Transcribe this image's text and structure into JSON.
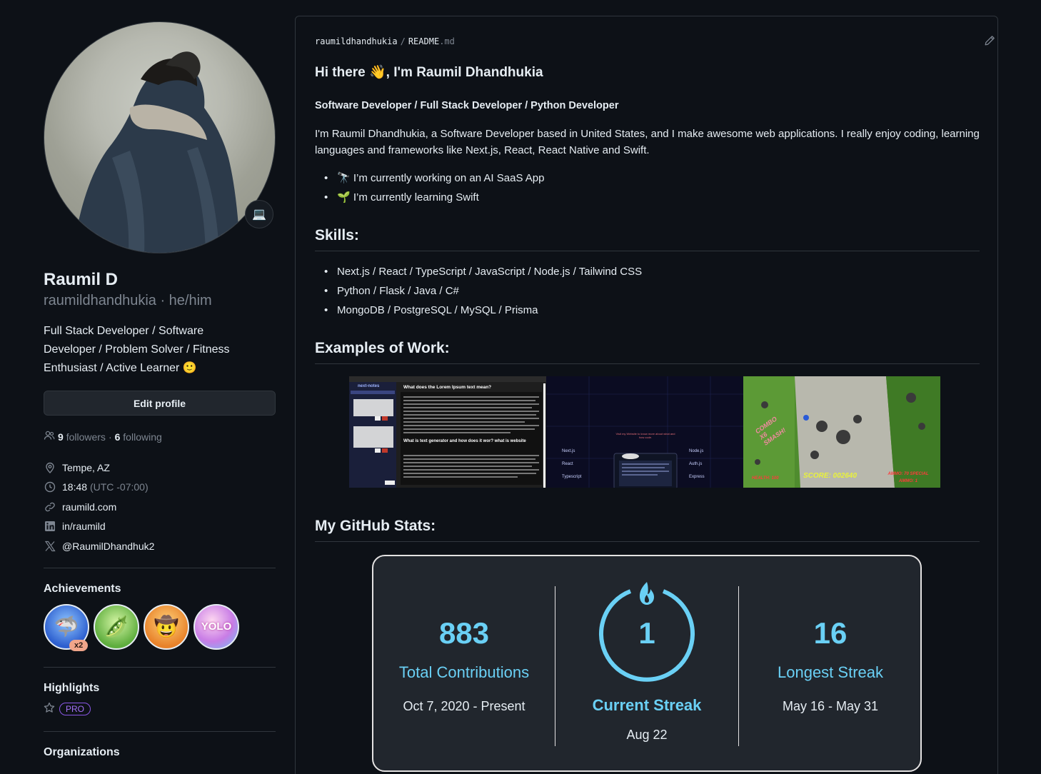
{
  "profile": {
    "name": "Raumil D",
    "login": "raumildhandhukia",
    "pronouns": "he/him",
    "bio": "Full Stack Developer / Software Developer / Problem Solver / Fitness Enthusiast / Active Learner 🙂",
    "status_emoji": "💻",
    "edit_label": "Edit profile",
    "followers_count": "9",
    "followers_label": "followers",
    "following_count": "6",
    "following_label": "following",
    "location": "Tempe, AZ",
    "local_time": "18:48",
    "timezone": "(UTC -07:00)",
    "website": "raumild.com",
    "linkedin": "in/raumild",
    "twitter": "@RaumilDhandhuk2"
  },
  "achievements": {
    "title": "Achievements",
    "badges": [
      {
        "name": "shark",
        "glyph": "🦈",
        "count": "x2",
        "color": "#3b6fd8"
      },
      {
        "name": "pea-pod",
        "glyph": "🫛",
        "color": "#6fbf4a"
      },
      {
        "name": "cowboy",
        "glyph": "🤠",
        "color": "#e88a2e"
      },
      {
        "name": "yolo",
        "glyph": "YOLO",
        "color": "#e97fc0"
      }
    ]
  },
  "highlights": {
    "title": "Highlights",
    "pro_label": "PRO"
  },
  "organizations": {
    "title": "Organizations"
  },
  "readme": {
    "path_user": "raumildhandhukia",
    "path_file": "README",
    "path_ext": ".md",
    "greeting": "Hi there 👋, I'm Raumil Dhandhukia",
    "roles": "Software Developer / Full Stack Developer / Python Developer",
    "intro": "I'm Raumil Dhandhukia, a Software Developer based in United States, and I make awesome web applications. I really enjoy coding, learning languages and frameworks like Next.js, React, React Native and Swift.",
    "bullets": [
      "🔭 I’m currently working on an AI SaaS App",
      "🌱 I’m currently learning Swift"
    ],
    "skills_title": "Skills:",
    "skills": [
      "Next.js / React / TypeScript / JavaScript / Node.js / Tailwind CSS",
      "Python / Flask / Java / C#",
      "MongoDB / PostgreSQL / MySQL / Prisma"
    ],
    "work_title": "Examples of Work:",
    "stats_title": "My GitHub Stats:"
  },
  "shots": {
    "notes_title": "What does the Lorem Ipsum text mean?",
    "notes_app": "next-notes",
    "notes_q2": "What is text generator and how does it wor? what is website",
    "portfolio_caption": "Visit my Website to know more about what and how code.",
    "portfolio_left": [
      "Next.js",
      "React",
      "Typescript"
    ],
    "portfolio_right": [
      "Node.js",
      "Auth.js",
      "Express"
    ],
    "game_score": "SCORE: 002640",
    "game_health": "HEALTH: 100",
    "game_combo": "COMBO X6 SMASH!",
    "game_ammo": "AMMO: 70 SPECIAL AMMO: 1"
  },
  "stats": {
    "total": "883",
    "total_label": "Total Contributions",
    "total_range": "Oct 7, 2020 - Present",
    "current": "1",
    "current_label": "Current Streak",
    "current_range": "Aug 22",
    "longest": "16",
    "longest_label": "Longest Streak",
    "longest_range": "May 16 - May 31",
    "accent": "#6ad0f5"
  }
}
